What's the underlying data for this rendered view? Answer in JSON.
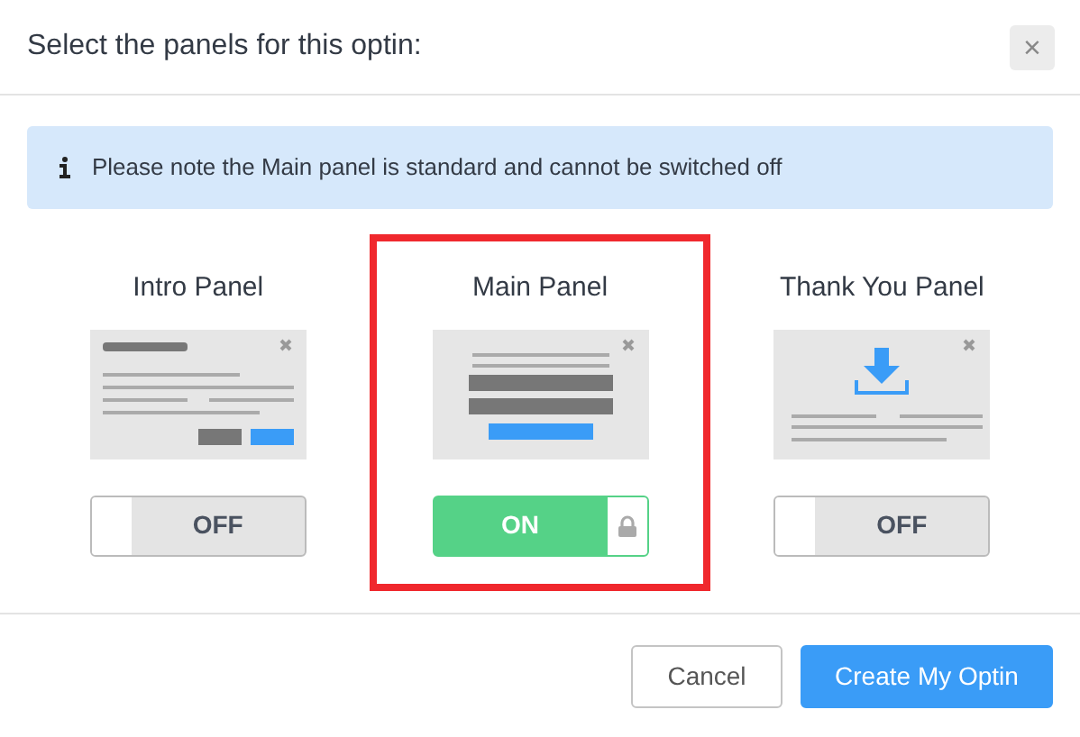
{
  "modal": {
    "title": "Select the panels for this optin:",
    "close": "×"
  },
  "notice": "Please note the Main panel is standard and cannot be switched off",
  "panels": [
    {
      "title": "Intro Panel",
      "kind": "intro",
      "on": false,
      "locked": false,
      "highlighted": false,
      "toggle_label": "OFF"
    },
    {
      "title": "Main Panel",
      "kind": "main",
      "on": true,
      "locked": true,
      "highlighted": true,
      "toggle_label": "ON"
    },
    {
      "title": "Thank You Panel",
      "kind": "thanks",
      "on": false,
      "locked": false,
      "highlighted": false,
      "toggle_label": "OFF"
    }
  ],
  "buttons": [
    {
      "label": "Cancel",
      "kind": "secondary"
    },
    {
      "label": "Create My Optin",
      "kind": "primary"
    }
  ]
}
